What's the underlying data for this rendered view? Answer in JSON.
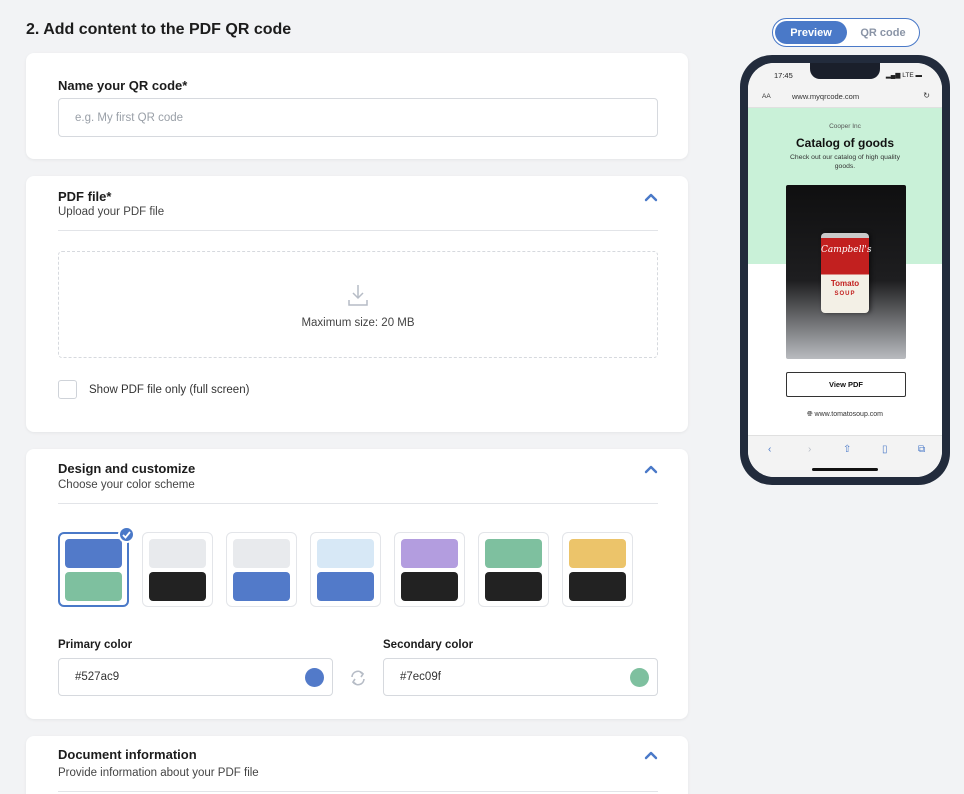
{
  "page": {
    "heading": "2. Add content to the PDF QR code"
  },
  "name_card": {
    "title": "Name your QR code*",
    "input_placeholder": "e.g. My first QR code"
  },
  "pdf_card": {
    "title": "PDF file*",
    "subtitle": "Upload your PDF file",
    "dropzone_text": "Maximum size: 20 MB",
    "checkbox_label": "Show PDF file only (full screen)",
    "checkbox_checked": false
  },
  "design_card": {
    "title": "Design and customize",
    "subtitle": "Choose your color scheme",
    "swatches": [
      {
        "top": "#527ac9",
        "bottom": "#7ec09f",
        "selected": true
      },
      {
        "top": "#e8eaed",
        "bottom": "#222222",
        "selected": false
      },
      {
        "top": "#e8eaed",
        "bottom": "#527ac9",
        "selected": false
      },
      {
        "top": "#d7e8f6",
        "bottom": "#527ac9",
        "selected": false
      },
      {
        "top": "#b39ddf",
        "bottom": "#222222",
        "selected": false
      },
      {
        "top": "#7ec09f",
        "bottom": "#222222",
        "selected": false
      },
      {
        "top": "#ecc46a",
        "bottom": "#222222",
        "selected": false
      }
    ],
    "primary_label": "Primary color",
    "primary_value": "#527ac9",
    "secondary_label": "Secondary color",
    "secondary_value": "#7ec09f"
  },
  "document_card": {
    "title": "Document information",
    "subtitle": "Provide information about your PDF file"
  },
  "preview_toggle": {
    "active": "Preview",
    "inactive": "QR code"
  },
  "phone": {
    "time": "17:45",
    "signal": "LTE",
    "aa": "AA",
    "url": "www.myqrcode.com",
    "company": "Cooper Inc",
    "catalog_title": "Catalog of goods",
    "catalog_desc": "Check out our catalog of high quality goods.",
    "can_brand": "Campbell's",
    "can_product": "Tomato",
    "can_sub": "SOUP",
    "view_pdf": "View PDF",
    "website": "www.tomatosoup.com"
  },
  "colors": {
    "accent": "#4a79c8",
    "hero_bg": "#c9f1d8"
  }
}
